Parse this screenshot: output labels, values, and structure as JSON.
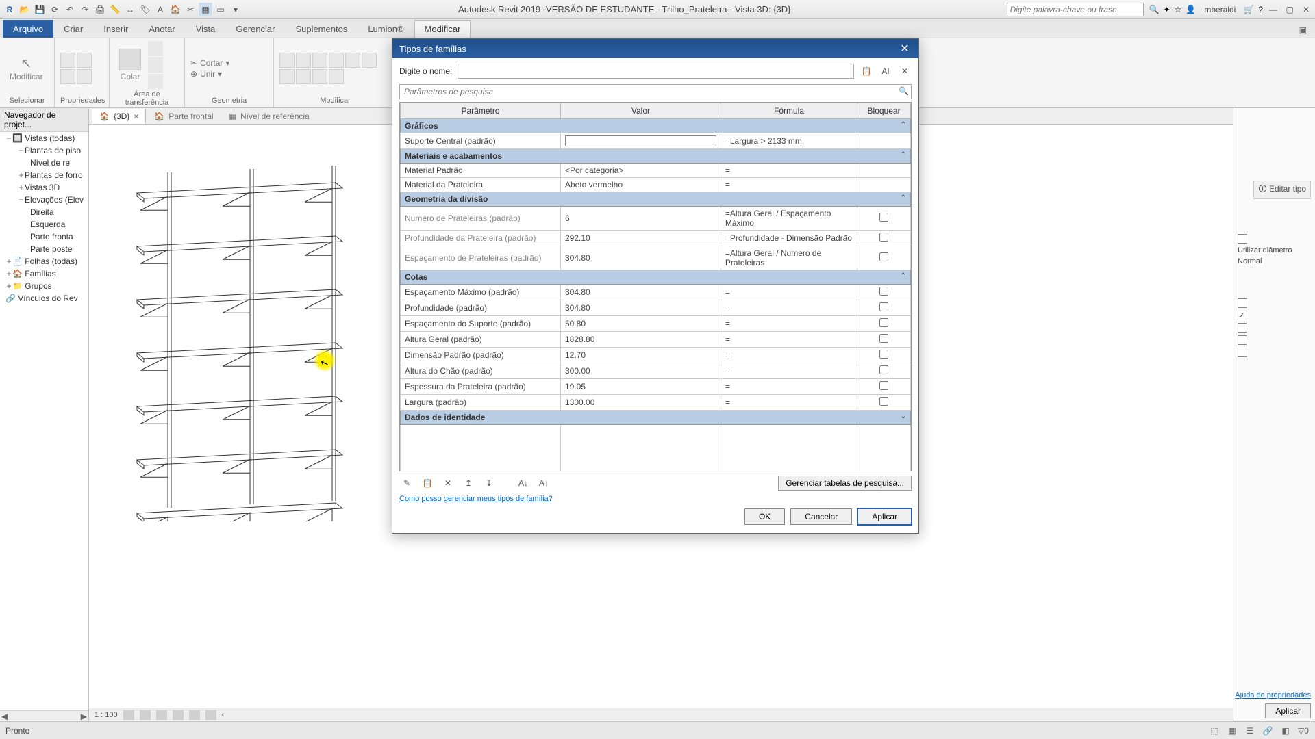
{
  "titlebar": {
    "title": "Autodesk Revit 2019 -VERSÃO DE ESTUDANTE - Trilho_Prateleira - Vista 3D: {3D}",
    "search_placeholder": "Digite palavra-chave ou frase",
    "user": "mberaldi"
  },
  "ribbon": {
    "file": "Arquivo",
    "tabs": [
      "Criar",
      "Inserir",
      "Anotar",
      "Vista",
      "Gerenciar",
      "Suplementos",
      "Lumion®",
      "Modificar"
    ],
    "active": "Modificar",
    "groups": {
      "selecionar": "Selecionar",
      "propriedades": "Propriedades",
      "area": "Área de transferência",
      "geometria": "Geometria",
      "modificar": "Modificar",
      "modificar_btn": "Modificar",
      "colar": "Colar",
      "cortar": "Cortar",
      "unir": "Unir"
    }
  },
  "browser": {
    "title": "Navegador de projet...",
    "items": [
      "Vistas (todas)",
      "Plantas de piso",
      "Nível de re",
      "Plantas de forro",
      "Vistas 3D",
      "Elevações (Elev",
      "Direita",
      "Esquerda",
      "Parte fronta",
      "Parte poste",
      "Folhas (todas)",
      "Famílias",
      "Grupos",
      "Vínculos do Rev"
    ]
  },
  "viewtabs": {
    "t1": "{3D}",
    "t2": "Parte frontal",
    "t3": "Nível de referência"
  },
  "viewbar": {
    "scale": "1 : 100"
  },
  "dialog": {
    "title": "Tipos de famílias",
    "name_label": "Digite o nome:",
    "search_placeholder": "Parâmetros de pesquisa",
    "cols": {
      "param": "Parâmetro",
      "valor": "Valor",
      "formula": "Fórmula",
      "bloquear": "Bloquear"
    },
    "groups": {
      "graficos": "Gráficos",
      "materiais": "Materiais e acabamentos",
      "geom": "Geometria da divisão",
      "cotas": "Cotas",
      "ident": "Dados de identidade"
    },
    "rows": {
      "suporte": {
        "p": "Suporte Central (padrão)",
        "v": "",
        "f": "=Largura > 2133 mm"
      },
      "matpad": {
        "p": "Material Padrão",
        "v": "<Por categoria>",
        "f": "="
      },
      "matprat": {
        "p": "Material da Prateleira",
        "v": "Abeto vermelho",
        "f": "="
      },
      "numprat": {
        "p": "Numero de Prateleiras (padrão)",
        "v": "6",
        "f": "=Altura Geral / Espaçamento Máximo"
      },
      "profprat": {
        "p": "Profundidade da Prateleira (padrão)",
        "v": "292.10",
        "f": "=Profundidade - Dimensão Padrão"
      },
      "espprat": {
        "p": "Espaçamento de Prateleiras (padrão)",
        "v": "304.80",
        "f": "=Altura Geral / Numero de Prateleiras"
      },
      "espmax": {
        "p": "Espaçamento Máximo (padrão)",
        "v": "304.80",
        "f": "="
      },
      "prof": {
        "p": "Profundidade (padrão)",
        "v": "304.80",
        "f": "="
      },
      "espsup": {
        "p": "Espaçamento do Suporte (padrão)",
        "v": "50.80",
        "f": "="
      },
      "altgeral": {
        "p": "Altura Geral (padrão)",
        "v": "1828.80",
        "f": "="
      },
      "dimpad": {
        "p": "Dimensão Padrão (padrão)",
        "v": "12.70",
        "f": "="
      },
      "altchao": {
        "p": "Altura do Chão (padrão)",
        "v": "300.00",
        "f": "="
      },
      "espess": {
        "p": "Espessura da Prateleira (padrão)",
        "v": "19.05",
        "f": "="
      },
      "largura": {
        "p": "Largura (padrão)",
        "v": "1300.00",
        "f": "="
      }
    },
    "lookup_btn": "Gerenciar tabelas de pesquisa...",
    "help_link": "Como posso gerenciar meus tipos de família?",
    "ok": "OK",
    "cancel": "Cancelar",
    "apply": "Aplicar"
  },
  "right": {
    "edit_type": "Editar tipo",
    "use_diam": "Utilizar diâmetro",
    "normal": "Normal",
    "apply": "Aplicar",
    "link": "Ajuda de propriedades"
  },
  "status": {
    "ready": "Pronto"
  }
}
